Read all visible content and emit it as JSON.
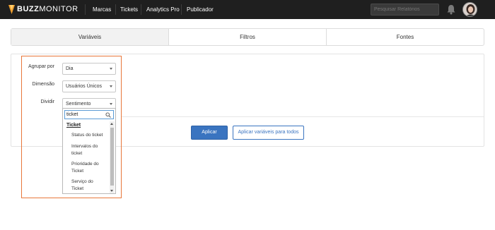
{
  "navbar": {
    "logo_bold": "BUZZ",
    "logo_light": "MONITOR",
    "items": [
      "Marcas",
      "Tickets",
      "Analytics Pro",
      "Publicador"
    ],
    "search_placeholder": "Pesquisar Relatórios"
  },
  "tabs": [
    "Variáveis",
    "Filtros",
    "Fontes"
  ],
  "form": {
    "group_by": {
      "label": "Agrupar por",
      "value": "Dia"
    },
    "dimension": {
      "label": "Dimensão",
      "value": "Usuários Únicos"
    },
    "split": {
      "label": "Dividir",
      "value": "Sentimento"
    }
  },
  "dropdown": {
    "search_value": "ticket",
    "group_label": "Ticket",
    "items": [
      {
        "line1": "Status do ticket",
        "line2": ""
      },
      {
        "line1": "Intervalos do",
        "line2": "ticket"
      },
      {
        "line1": "Prioridade do",
        "line2": "Ticket"
      },
      {
        "line1": "Serviço do",
        "line2": "Ticket"
      }
    ]
  },
  "buttons": {
    "apply": "Aplicar",
    "apply_all": "Aplicar variáveis para todos"
  },
  "colors": {
    "navbar_bg": "#1f1f1f",
    "highlight": "#e8773a",
    "primary": "#3a74c0"
  }
}
